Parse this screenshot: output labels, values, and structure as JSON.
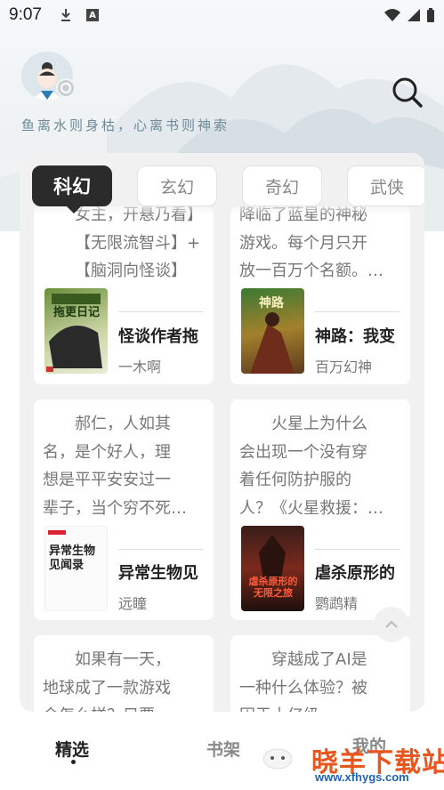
{
  "status_bar": {
    "time": "9:07",
    "icons": [
      "download-icon",
      "a-notification-icon",
      "wifi-icon",
      "signal-icon",
      "battery-icon"
    ]
  },
  "header": {
    "avatar": "avatar-monk",
    "slogan": "鱼离水则身枯，心离书则神索",
    "search_icon": "search-icon"
  },
  "tabs": [
    {
      "label": "科幻",
      "active": true
    },
    {
      "label": "玄幻",
      "active": false
    },
    {
      "label": "奇幻",
      "active": false
    },
    {
      "label": "武侠",
      "active": false
    }
  ],
  "books": [
    {
      "intro_lines": [
        "女主，开悬乃看】",
        "【无限流智斗】+",
        "【脑洞向怪谈】+…"
      ],
      "title": "怪谈作者拖",
      "author": "一木啊",
      "cover_text": "拖更日记"
    },
    {
      "intro_lines": [
        "降临了蓝星的神秘",
        "游戏。每个月只开",
        "放一百万个名额。…"
      ],
      "title": "神路：我变",
      "author": "百万幻神",
      "cover_text": "神路"
    },
    {
      "intro_lines": [
        "郝仁，人如其",
        "名，是个好人，理",
        "想是平平安安过一",
        "辈子，当个穷不死…"
      ],
      "title": "异常生物见",
      "author": "远瞳",
      "cover_text": "异常生物见闻录"
    },
    {
      "intro_lines": [
        "火星上为什么",
        "会出现一个没有穿",
        "着任何防护服的",
        "人？《火星救援：…"
      ],
      "title": "虐杀原形的",
      "author": "鹦鹉精",
      "cover_text": "虐杀原形的无限之旅"
    },
    {
      "intro_lines": [
        "如果有一天，",
        "地球成了一款游戏",
        "会怎么样？只要…"
      ],
      "title": "",
      "author": "",
      "cover_text": ""
    },
    {
      "intro_lines": [
        "穿越成了AI是",
        "一种什么体验？被",
        "困于十亿级"
      ],
      "title": "",
      "author": "",
      "cover_text": ""
    }
  ],
  "bottom_nav": [
    {
      "label": "精选",
      "active": true
    },
    {
      "label": "书架",
      "active": false
    },
    {
      "label": "我的",
      "active": false
    }
  ],
  "watermark": {
    "text": "晓羊下载站",
    "url": "www.xfhygs.com"
  },
  "colors": {
    "active_tab": "#2b2b2b",
    "panel_bg": "#f1f1f2",
    "slogan": "#6b8a9a",
    "watermark_orange": "#e8551d",
    "watermark_blue": "#1e63b6"
  }
}
